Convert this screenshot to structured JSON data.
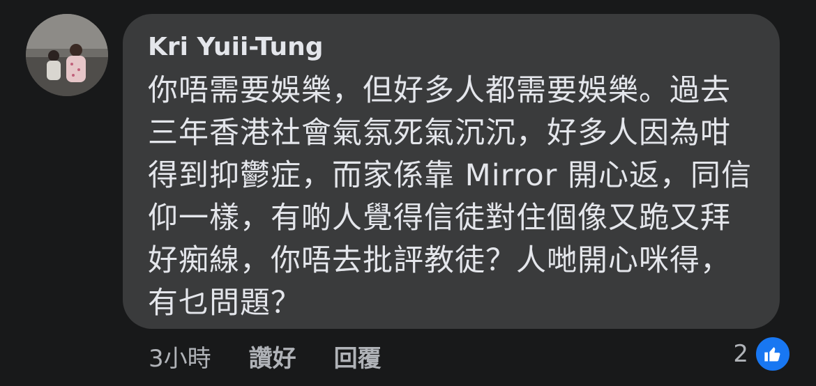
{
  "comment": {
    "author": "Kri Yuii-Tung",
    "text_lines": [
      "你唔需要娛樂，但好多人都需要娛樂。過去",
      "三年香港社會氣氛死氣沉沉，好多人因為咁",
      "得到抑鬱症，而家係靠 Mirror 開心返，同信",
      "仰一樣，有啲人覺得信徒對住個像又跪又拜",
      "好痴線，你唔去批評教徒？人哋開心咪得，",
      "有乜問題？"
    ]
  },
  "actions": {
    "timestamp": "3小時",
    "like_label": "讚好",
    "reply_label": "回覆"
  },
  "reactions": {
    "count": "2",
    "icon": "thumbs-up-icon",
    "color": "#1877f2"
  },
  "colors": {
    "background": "#18191a",
    "bubble": "#3a3b3c",
    "primary_text": "#e4e6eb",
    "secondary_text": "#b0b3b8"
  }
}
